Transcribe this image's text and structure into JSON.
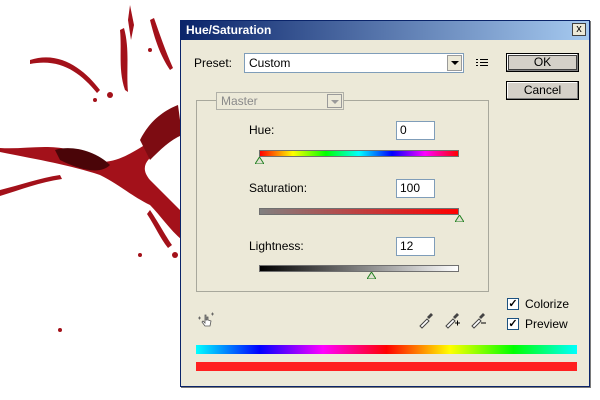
{
  "dialog": {
    "title": "Hue/Saturation",
    "close_label": "x",
    "preset_label": "Preset:",
    "preset_value": "Custom",
    "ok_label": "OK",
    "cancel_label": "Cancel"
  },
  "adjust": {
    "channel_value": "Master",
    "hue": {
      "label": "Hue:",
      "value": "0",
      "slider_fraction": 0.0
    },
    "saturation": {
      "label": "Saturation:",
      "value": "100",
      "slider_fraction": 1.0
    },
    "lightness": {
      "label": "Lightness:",
      "value": "12",
      "slider_fraction": 0.56
    }
  },
  "options": {
    "colorize_label": "Colorize",
    "colorize_checked": true,
    "preview_label": "Preview",
    "preview_checked": true,
    "check_mark": "✓"
  },
  "icons": [
    "preset-menu-icon",
    "targeted-adjustment-icon",
    "eyedropper-icon",
    "eyedropper-add-icon",
    "eyedropper-subtract-icon",
    "slider-thumb-icon",
    "close-icon"
  ],
  "colors": {
    "titlebar_start": "#0a246a",
    "titlebar_end": "#a6caf0",
    "dialog_bg": "#ece9d8",
    "output_bar": "#ff2020",
    "splatter": "#a3111a"
  }
}
